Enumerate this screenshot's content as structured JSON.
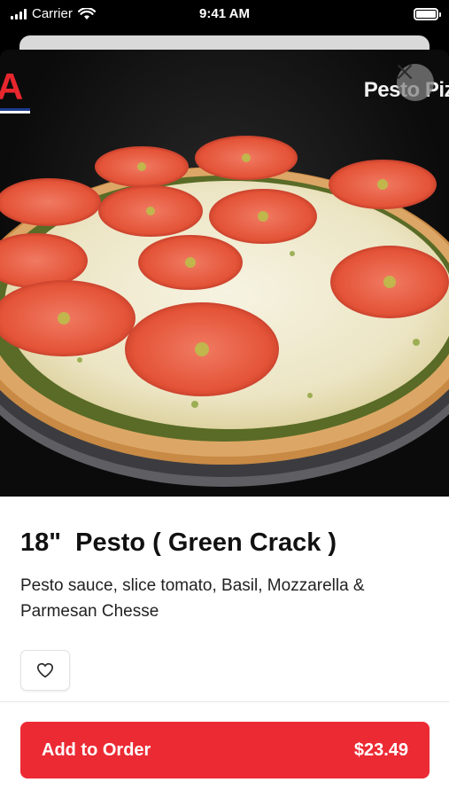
{
  "status_bar": {
    "carrier": "Carrier",
    "time": "9:41 AM"
  },
  "hero": {
    "brand_letter": "A",
    "caption": "Pesto Piz",
    "close_icon": "close-icon"
  },
  "item": {
    "title": "18\"  Pesto ( Green Crack )",
    "description": "Pesto sauce, slice tomato, Basil, Mozzarella & Parmesan Chesse"
  },
  "favorite": {
    "icon": "heart-icon"
  },
  "order": {
    "label": "Add to Order",
    "price": "$23.49"
  },
  "colors": {
    "accent": "#ec2a33",
    "tomato": "#e8553f",
    "cheese": "#f2efdc",
    "pesto": "#5a6b2a",
    "crust": "#d9a25e"
  }
}
